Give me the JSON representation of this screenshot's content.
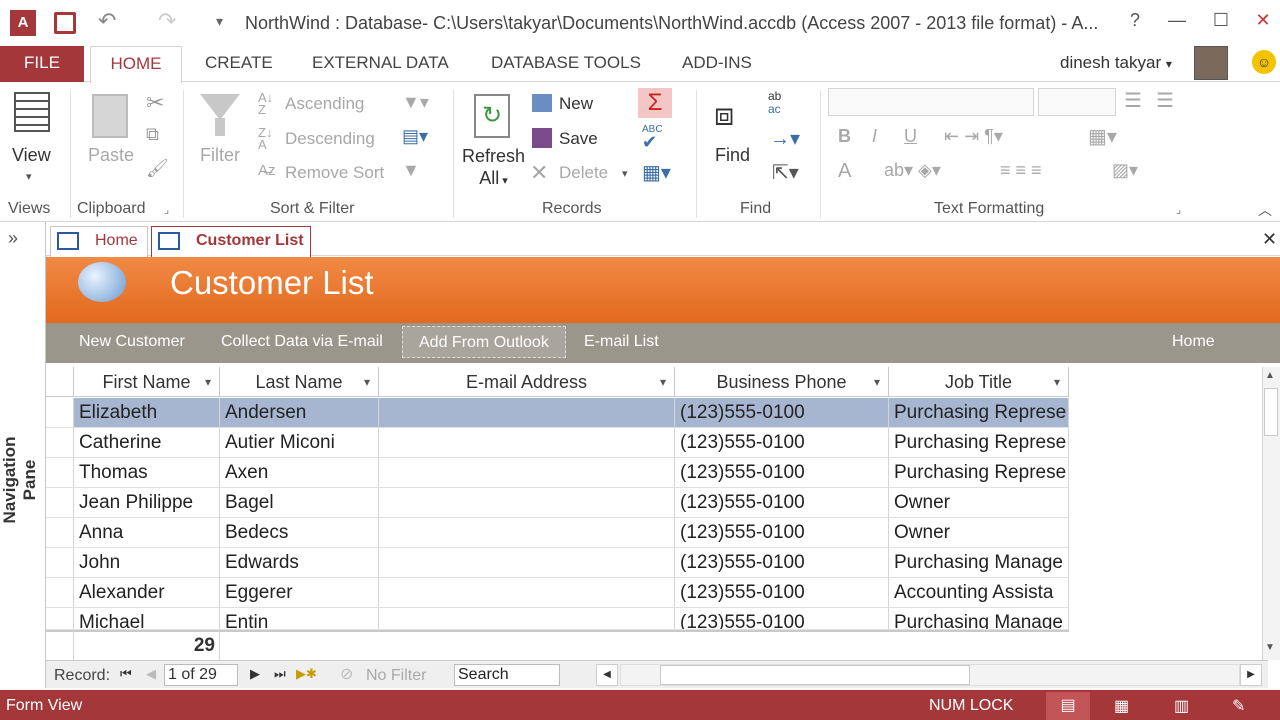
{
  "window": {
    "title": "NorthWind : Database- C:\\Users\\takyar\\Documents\\NorthWind.accdb (Access 2007 - 2013 file format) - A...",
    "help": "?",
    "minimize": "—",
    "maximize": "☐",
    "close": "✕"
  },
  "ribbon_tabs": [
    "FILE",
    "HOME",
    "CREATE",
    "EXTERNAL DATA",
    "DATABASE TOOLS",
    "ADD-INS"
  ],
  "user": "dinesh takyar",
  "ribbon": {
    "views": {
      "view": "View",
      "group": "Views"
    },
    "clipboard": {
      "paste": "Paste",
      "group": "Clipboard"
    },
    "sort": {
      "filter": "Filter",
      "ascending": "Ascending",
      "descending": "Descending",
      "remove_sort": "Remove Sort",
      "group": "Sort & Filter"
    },
    "records": {
      "refresh": "Refresh",
      "all": "All",
      "new": "New",
      "save": "Save",
      "delete": "Delete",
      "group": "Records"
    },
    "find": {
      "find": "Find",
      "group": "Find"
    },
    "text": {
      "group": "Text Formatting",
      "bold": "B",
      "italic": "I",
      "underline": "U",
      "font_color": "A"
    }
  },
  "doc_tabs": [
    "Home",
    "Customer List"
  ],
  "form": {
    "title": "Customer List",
    "commands": [
      "New Customer",
      "Collect Data via E-mail",
      "Add From Outlook",
      "E-mail List"
    ],
    "home_link": "Home"
  },
  "nav_pane": {
    "label": "Navigation Pane",
    "toggle": "»"
  },
  "grid": {
    "columns": [
      "First Name",
      "Last Name",
      "E-mail Address",
      "Business Phone",
      "Job Title"
    ],
    "rows": [
      [
        "Elizabeth",
        "Andersen",
        "",
        "(123)555-0100",
        "Purchasing Represe"
      ],
      [
        "Catherine",
        "Autier Miconi",
        "",
        "(123)555-0100",
        "Purchasing Represe"
      ],
      [
        "Thomas",
        "Axen",
        "",
        "(123)555-0100",
        "Purchasing Represe"
      ],
      [
        "Jean Philippe",
        "Bagel",
        "",
        "(123)555-0100",
        "Owner"
      ],
      [
        "Anna",
        "Bedecs",
        "",
        "(123)555-0100",
        "Owner"
      ],
      [
        "John",
        "Edwards",
        "",
        "(123)555-0100",
        "Purchasing Manage"
      ],
      [
        "Alexander",
        "Eggerer",
        "",
        "(123)555-0100",
        "Accounting Assista"
      ],
      [
        "Michael",
        "Entin",
        "",
        "(123)555-0100",
        "Purchasing Manage"
      ]
    ],
    "total": "29"
  },
  "record_nav": {
    "label": "Record:",
    "position": "1 of 29",
    "filter": "No Filter",
    "search": "Search"
  },
  "status": {
    "left": "Form View",
    "numlock": "NUM LOCK"
  },
  "colors": {
    "accent": "#a4373a",
    "banner": "#e36a1f",
    "selected_row": "#a7b6d0"
  }
}
